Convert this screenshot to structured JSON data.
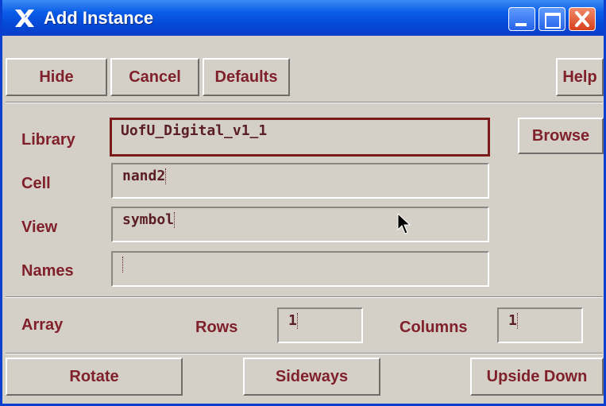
{
  "window": {
    "title": "Add Instance"
  },
  "toolbar": {
    "hide": "Hide",
    "cancel": "Cancel",
    "defaults": "Defaults",
    "help": "Help"
  },
  "fields": {
    "library": {
      "label": "Library",
      "value": "UofU_Digital_v1_1"
    },
    "cell": {
      "label": "Cell",
      "value": "nand2"
    },
    "view": {
      "label": "View",
      "value": "symbol"
    },
    "names": {
      "label": "Names",
      "value": ""
    }
  },
  "browse": "Browse",
  "array": {
    "label": "Array",
    "rows_label": "Rows",
    "rows_value": "1",
    "columns_label": "Columns",
    "columns_value": "1"
  },
  "actions": {
    "rotate": "Rotate",
    "sideways": "Sideways",
    "upside_down": "Upside Down"
  }
}
